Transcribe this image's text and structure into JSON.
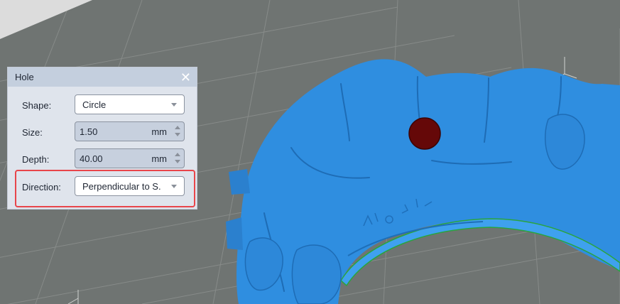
{
  "panel": {
    "title": "Hole",
    "close_glyph": "✕",
    "fields": {
      "shape": {
        "label": "Shape:",
        "value": "Circle"
      },
      "size": {
        "label": "Size:",
        "value": "1.50",
        "unit": "mm"
      },
      "depth": {
        "label": "Depth:",
        "value": "40.00",
        "unit": "mm"
      },
      "direction": {
        "label": "Direction:",
        "value": "Perpendicular to S."
      }
    }
  },
  "icons": {
    "close": "close-icon",
    "dropdown": "chevron-down-icon",
    "spin_up": "spin-up-icon",
    "spin_down": "spin-down-icon"
  },
  "colors": {
    "viewport_bg": "#6f7472",
    "grid_line": "#888c8a",
    "model_blue": "#2f8ee0",
    "hole_marker": "#650808",
    "highlight": "#e8454a",
    "panel_bg": "#dfe4ec"
  }
}
